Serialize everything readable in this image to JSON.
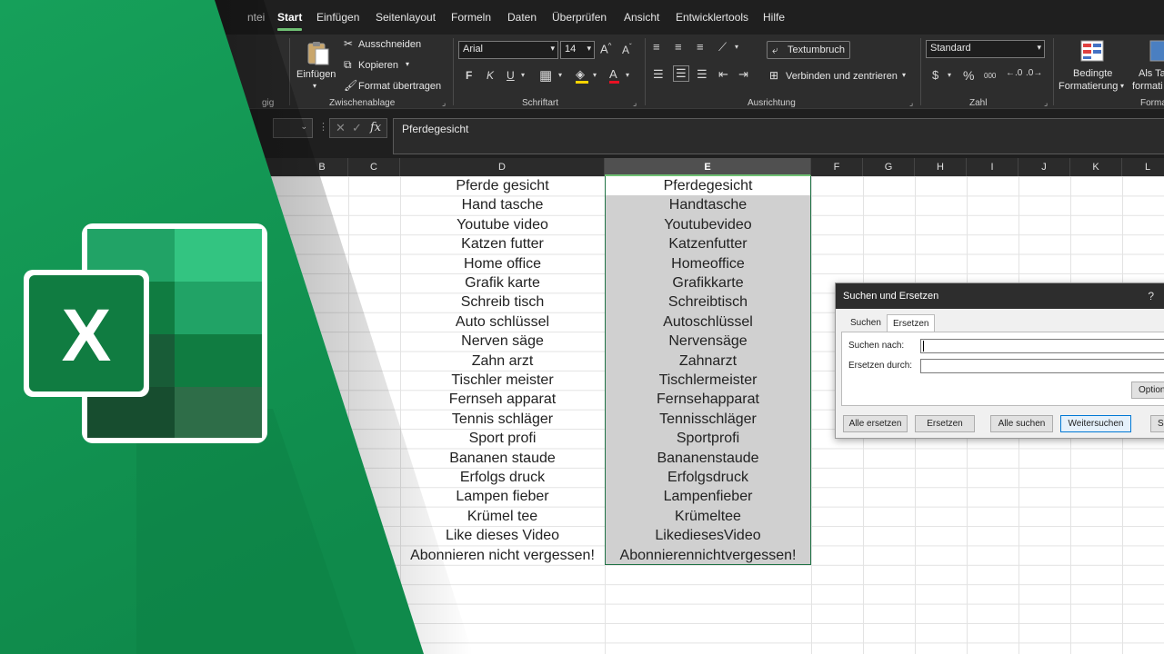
{
  "ribbon_tabs": [
    "ntei",
    "Start",
    "Einfügen",
    "Seitenlayout",
    "Formeln",
    "Daten",
    "Überprüfen",
    "Ansicht",
    "Entwicklertools",
    "Hilfe"
  ],
  "ribbon": {
    "clipboard": {
      "paste": "Einfügen",
      "cut": "Ausschneiden",
      "copy": "Kopieren",
      "format_painter": "Format übertragen",
      "label": "Zwischenablage",
      "prev_group_tail": "gig"
    },
    "font": {
      "name": "Arial",
      "size": "14",
      "label": "Schriftart",
      "bold": "F",
      "italic": "K",
      "underline": "U"
    },
    "alignment": {
      "wrap": "Textumbruch",
      "merge": "Verbinden und zentrieren",
      "label": "Ausrichtung"
    },
    "number": {
      "format": "Standard",
      "label": "Zahl",
      "currency": "$",
      "percent": "%",
      "thousands": "000"
    },
    "styles": {
      "conditional_1": "Bedingte",
      "conditional_2": "Formatierung",
      "table_1": "Als Ta",
      "table_2": "formati",
      "label": "Forma"
    }
  },
  "formula_bar": {
    "value": "Pferdegesicht",
    "fx": "fx"
  },
  "columns": [
    "B",
    "C",
    "D",
    "E",
    "F",
    "G",
    "H",
    "I",
    "J",
    "K",
    "L"
  ],
  "rows": [
    {
      "d": "Pferde gesicht",
      "e": "Pferdegesicht"
    },
    {
      "d": "Hand tasche",
      "e": "Handtasche"
    },
    {
      "d": "Youtube video",
      "e": "Youtubevideo"
    },
    {
      "d": "Katzen futter",
      "e": "Katzenfutter"
    },
    {
      "d": "Home office",
      "e": "Homeoffice"
    },
    {
      "d": "Grafik karte",
      "e": "Grafikkarte"
    },
    {
      "d": "Schreib tisch",
      "e": "Schreibtisch"
    },
    {
      "d": "Auto schlüssel",
      "e": "Autoschlüssel"
    },
    {
      "d": "Nerven säge",
      "e": "Nervensäge"
    },
    {
      "d": "Zahn arzt",
      "e": "Zahnarzt"
    },
    {
      "d": "Tischler meister",
      "e": "Tischlermeister"
    },
    {
      "d": "Fernseh apparat",
      "e": "Fernsehapparat"
    },
    {
      "d": "Tennis schläger",
      "e": "Tennisschläger"
    },
    {
      "d": "Sport profi",
      "e": "Sportprofi"
    },
    {
      "d": "Bananen staude",
      "e": "Bananenstaude"
    },
    {
      "d": "Erfolgs druck",
      "e": "Erfolgsdruck"
    },
    {
      "d": "Lampen fieber",
      "e": "Lampenfieber"
    },
    {
      "d": "Krümel tee",
      "e": "Krümeltee"
    },
    {
      "d": "Like dieses Video",
      "e": "LikediesesVideo"
    },
    {
      "d": "Abonnieren nicht vergessen!",
      "e": "Abonnierennichtvergessen!"
    }
  ],
  "dialog": {
    "title": "Suchen und Ersetzen",
    "help": "?",
    "tab_find": "Suchen",
    "tab_replace": "Ersetzen",
    "find_label": "Suchen nach:",
    "replace_label": "Ersetzen durch:",
    "options": "Option",
    "replace_all": "Alle ersetzen",
    "replace": "Ersetzen",
    "find_all": "Alle suchen",
    "find_next": "Weitersuchen",
    "close": "Sc"
  },
  "logo": {
    "letter": "X"
  },
  "colors": {
    "accent_green": "#1e9e5a",
    "dark_green": "#0f7a3e"
  }
}
